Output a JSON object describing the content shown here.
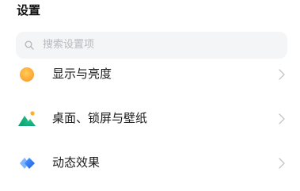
{
  "header": {
    "title": "设置"
  },
  "search": {
    "placeholder": "搜索设置项",
    "icon": "search-icon"
  },
  "settings_items": [
    {
      "label": "显示与亮度",
      "icon": "display-brightness-icon",
      "color": "#ffb23f"
    },
    {
      "label": "桌面、锁屏与壁纸",
      "icon": "desktop-wallpaper-icon",
      "color": "#1fc28a"
    },
    {
      "label": "动态效果",
      "icon": "dynamic-effects-icon",
      "color": "#2f7bf6"
    }
  ],
  "colors": {
    "accent_orange": "#ffb23f",
    "accent_green": "#1fc28a",
    "accent_blue": "#2f7bf6"
  }
}
